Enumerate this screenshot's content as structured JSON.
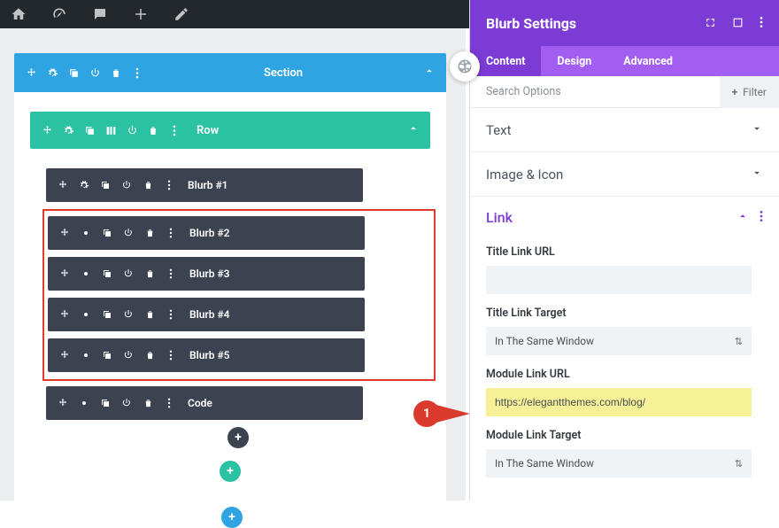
{
  "sectionLabel": "Section",
  "rowLabel": "Row",
  "blurbs": [
    "Blurb #1",
    "Blurb #2",
    "Blurb #3",
    "Blurb #4",
    "Blurb #5"
  ],
  "codeLabel": "Code",
  "panel": {
    "title": "Blurb Settings",
    "tabs": {
      "content": "Content",
      "design": "Design",
      "advanced": "Advanced"
    },
    "searchPlaceholder": "Search Options",
    "filterLabel": "Filter",
    "accText": "Text",
    "accImageIcon": "Image & Icon",
    "linkTitle": "Link",
    "fields": {
      "titleLinkUrl": {
        "label": "Title Link URL",
        "value": ""
      },
      "titleLinkTarget": {
        "label": "Title Link Target",
        "value": "In The Same Window"
      },
      "moduleLinkUrl": {
        "label": "Module Link URL",
        "value": "https://elegantthemes.com/blog/"
      },
      "moduleLinkTarget": {
        "label": "Module Link Target",
        "value": "In The Same Window"
      }
    }
  },
  "callout": "1"
}
